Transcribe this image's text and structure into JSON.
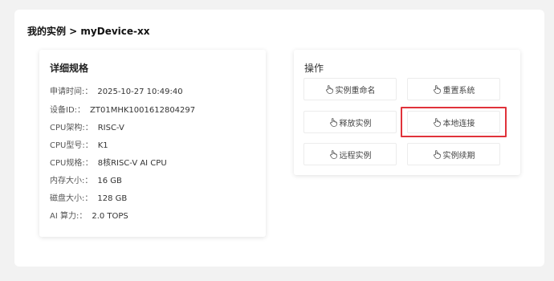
{
  "breadcrumb": "我的实例 > myDevice-xx",
  "spec": {
    "title": "详细规格",
    "rows": [
      {
        "label": "申请时间:：",
        "value": "2025-10-27 10:49:40"
      },
      {
        "label": "设备ID:：",
        "value": "ZT01MHK1001612804297"
      },
      {
        "label": "CPU架构:：",
        "value": "RISC-V"
      },
      {
        "label": "CPU型号:：",
        "value": "K1"
      },
      {
        "label": "CPU规格:：",
        "value": "8核RISC-V AI CPU"
      },
      {
        "label": "内存大小:：",
        "value": "16 GB"
      },
      {
        "label": "磁盘大小:：",
        "value": "128 GB"
      },
      {
        "label": "AI 算力:：",
        "value": "2.0 TOPS"
      }
    ]
  },
  "ops": {
    "title": "操作",
    "buttons": [
      {
        "label": "实例重命名",
        "icon": "hand-pointer-icon"
      },
      {
        "label": "重置系统",
        "icon": "hand-pointer-icon"
      },
      {
        "label": "释放实例",
        "icon": "hand-pointer-icon"
      },
      {
        "label": "本地连接",
        "icon": "hand-pointer-icon"
      },
      {
        "label": "远程实例",
        "icon": "hand-pointer-icon"
      },
      {
        "label": "实例续期",
        "icon": "hand-pointer-icon"
      }
    ]
  },
  "colors": {
    "highlight": "#e0323a",
    "background": "#f2f2f2"
  }
}
